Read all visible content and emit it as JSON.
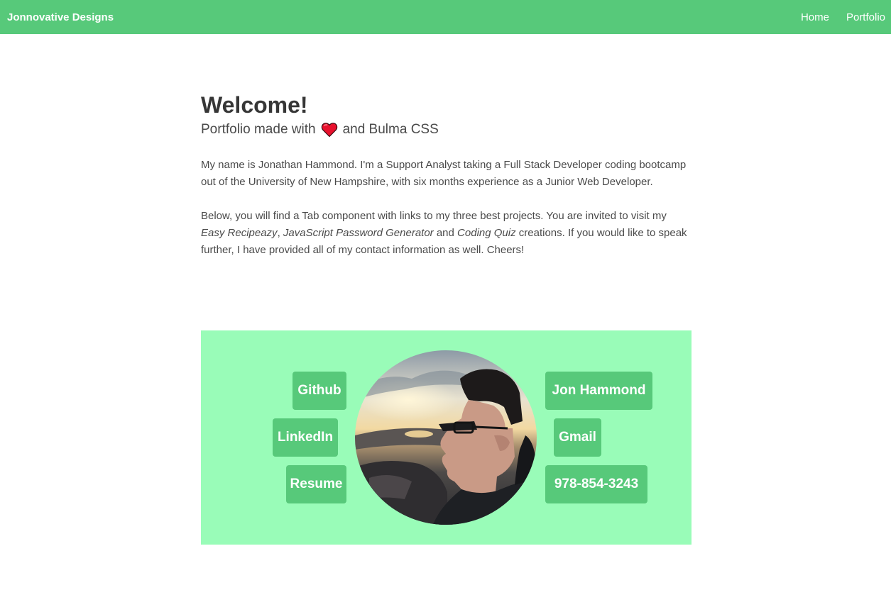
{
  "navbar": {
    "brand": "Jonnovative Designs",
    "links": [
      "Home",
      "Portfolio"
    ]
  },
  "hero": {
    "title": "Welcome!",
    "subtitle_before": "Portfolio made with",
    "subtitle_icon": "heart-icon",
    "subtitle_after": "and Bulma CSS"
  },
  "about": {
    "paragraph1": "My name is Jonathan Hammond. I'm a Support Analyst taking a Full Stack Developer coding bootcamp out of the University of New Hampshire, with six months experience as a Junior Web Developer.",
    "p2_a": "Below, you will find a Tab component with links to my three best projects. You are invited to visit my ",
    "p2_proj1": "Easy Recipeazy",
    "p2_sep1": ", ",
    "p2_proj2": "JavaScript Password Generator",
    "p2_sep2": " and ",
    "p2_proj3": "Coding Quiz",
    "p2_b": " creations. If you would like to speak further, I have provided all of my contact information as well. Cheers!"
  },
  "contact": {
    "github": "Github",
    "linkedin": "LinkedIn",
    "resume": "Resume",
    "name": "Jon Hammond",
    "gmail": "Gmail",
    "phone": "978-854-3243"
  },
  "colors": {
    "primary": "#57c97a",
    "contact_bg": "#99fcb8",
    "heart": "#e8112d"
  }
}
